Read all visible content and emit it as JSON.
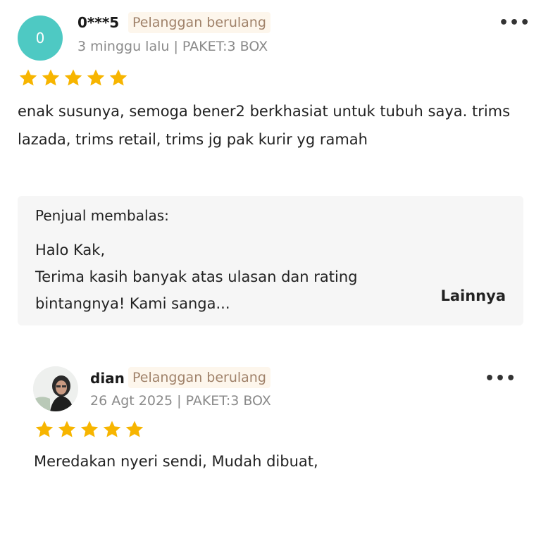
{
  "reviews": [
    {
      "avatar_initial": "0",
      "name": "0***5",
      "badge": "Pelanggan berulang",
      "meta": "3 minggu lalu | PAKET:3 BOX",
      "rating": 5,
      "text": "enak susunya, semoga bener2 berkhasiat untuk tubuh saya. trims lazada, trims retail, trims jg pak kurir yg ramah",
      "reply": {
        "title": "Penjual membalas:",
        "text_line1": "Halo Kak,",
        "text_line2": "Terima kasih banyak atas ulasan dan rating bintangnya! Kami sanga...",
        "more_label": "Lainnya"
      }
    },
    {
      "name": "dian",
      "badge": "Pelanggan berulang",
      "meta": "26 Agt 2025 | PAKET:3 BOX",
      "rating": 5,
      "text": "Meredakan nyeri sendi, Mudah dibuat,"
    }
  ],
  "more_icon": "ellipsis-icon",
  "colors": {
    "star": "#f7b500",
    "avatar": "#4ec9c3",
    "badge_text": "#a0826a"
  }
}
